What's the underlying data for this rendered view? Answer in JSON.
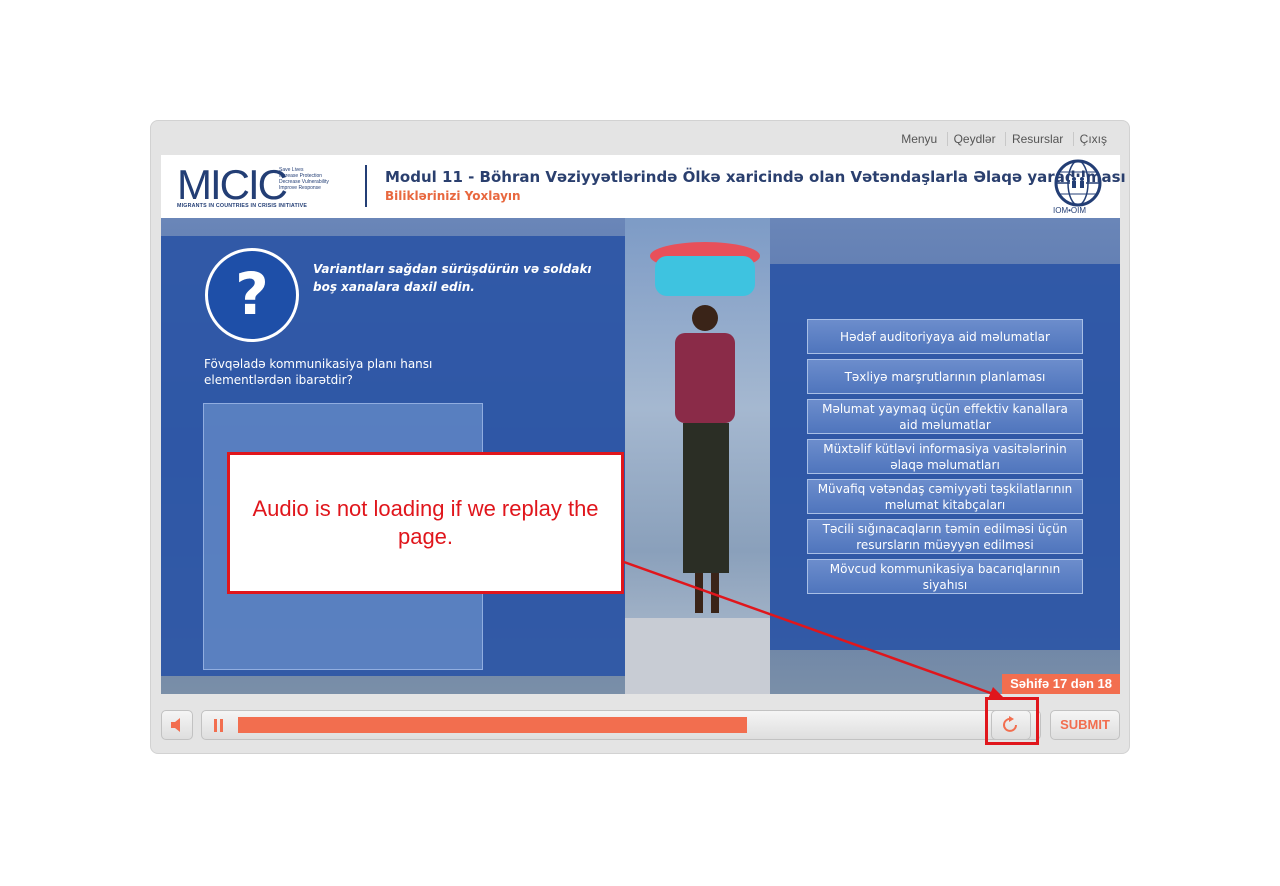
{
  "topnav": [
    "Menyu",
    "Qeydlər",
    "Resurslar",
    "Çıxış"
  ],
  "logo": {
    "name": "MICIC",
    "taglines": [
      "Save Lives",
      "Increase Protection",
      "Decrease Vulnerability",
      "Improve Response"
    ],
    "subtitle": "MIGRANTS IN COUNTRIES IN CRISIS INITIATIVE"
  },
  "module": {
    "title": "Modul 11 - Böhran Vəziyyətlərində Ölkə xaricində olan Vətəndaşlarla Əlaqə yaradılması",
    "subtitle": "Biliklərinizi Yoxlayın"
  },
  "iom_label": "IOM•OIM",
  "quiz": {
    "instruction": "Variantları sağdan sürüşdürün və soldakı boş xanalara daxil edin.",
    "question": "Fövqəladə kommunikasiya planı hansı elementlərdən ibarətdir?",
    "options": [
      "Hədəf auditoriyaya aid məlumatlar",
      "Təxliyə marşrutlarının planlaması",
      "Məlumat yaymaq üçün effektiv kanallara aid məlumatlar",
      "Müxtəlif kütləvi informasiya vasitələrinin əlaqə məlumatları",
      "Müvafiq vətəndaş cəmiyyəti təşkilatlarının məlumat kitabçaları",
      "Təcili sığınacaqların təmin edilməsi üçün resursların müəyyən edilməsi",
      "Mövcud kommunikasiya bacarıqlarının siyahısı"
    ]
  },
  "page_indicator": "Səhifə 17 dən 18",
  "controls": {
    "progress": 0.67,
    "submit_label": "SUBMIT"
  },
  "annotation": {
    "text": "Audio is not loading if we replay the page.",
    "color": "#e0161c"
  },
  "colors": {
    "accent": "#f26e4f",
    "brand_blue": "#233e75",
    "panel_blue": "#2d56a6"
  }
}
